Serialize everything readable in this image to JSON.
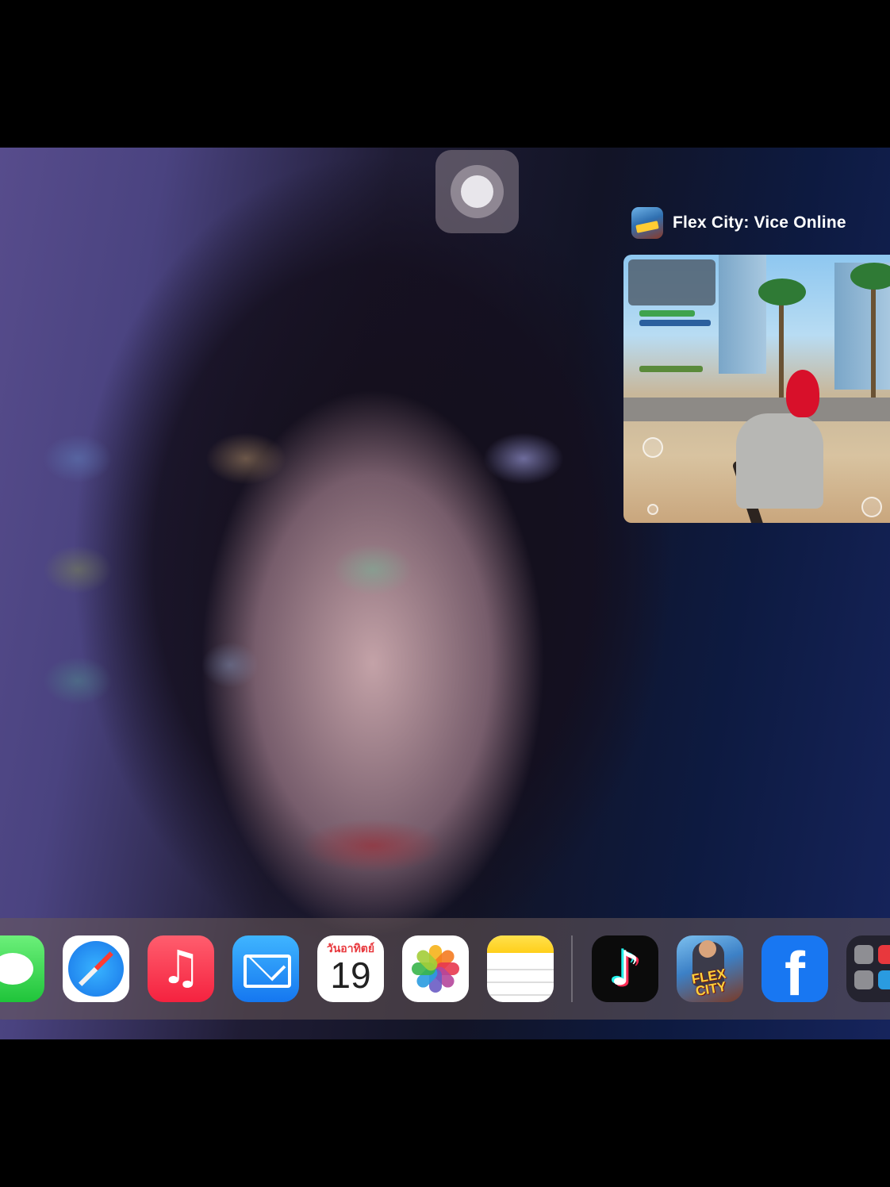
{
  "app_switcher": {
    "app_name": "Flex City: Vice Online",
    "app_icon": "flex-city-app-icon"
  },
  "home_indicator": {
    "icon": "assistive-touch-icon"
  },
  "dock": {
    "apps": [
      {
        "name": "Messages",
        "icon": "messages-icon"
      },
      {
        "name": "Safari",
        "icon": "safari-icon"
      },
      {
        "name": "Music",
        "icon": "music-icon",
        "glyph": "♫"
      },
      {
        "name": "Mail",
        "icon": "mail-icon"
      },
      {
        "name": "Calendar",
        "icon": "calendar-icon",
        "day_label": "วันอาทิตย์",
        "date": "19"
      },
      {
        "name": "Photos",
        "icon": "photos-icon"
      },
      {
        "name": "Notes",
        "icon": "notes-icon"
      }
    ],
    "recent_apps": [
      {
        "name": "TikTok",
        "icon": "tiktok-icon",
        "glyph": "♪"
      },
      {
        "name": "Flex City",
        "icon": "flex-city-icon",
        "logo_text": "FLEX CITY"
      },
      {
        "name": "Facebook",
        "icon": "facebook-icon",
        "glyph": "f"
      },
      {
        "name": "App Library",
        "icon": "app-folder-icon"
      }
    ]
  },
  "colors": {
    "facebook": "#1877f2",
    "messages": "#1fc43a",
    "music": "#f5223f",
    "mail": "#1577f0",
    "tiktok_cyan": "#25f4ee",
    "tiktok_red": "#fe2c55"
  }
}
